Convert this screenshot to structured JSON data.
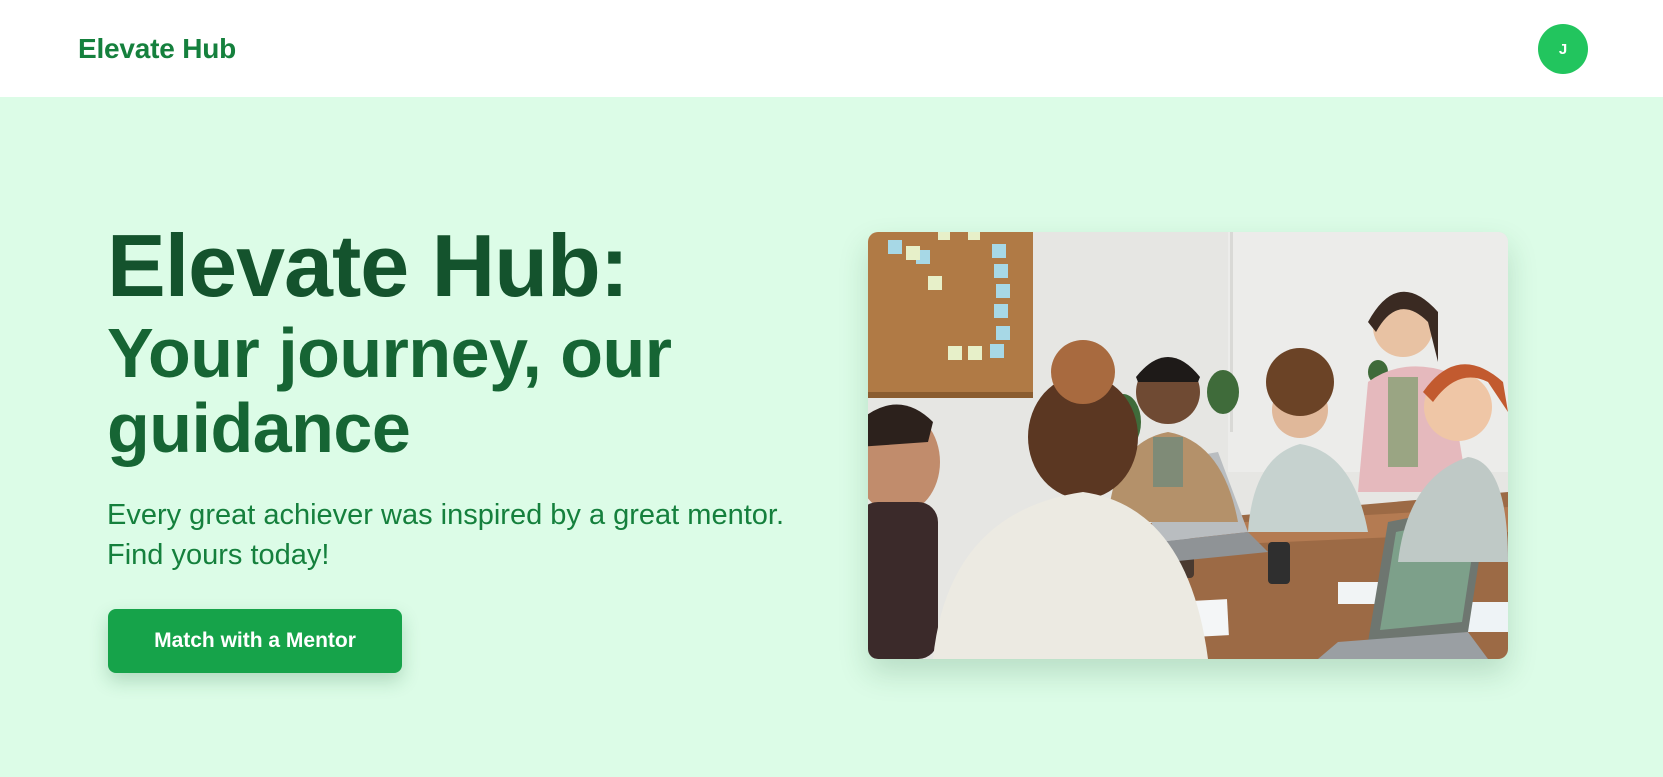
{
  "navbar": {
    "brand": "Elevate Hub",
    "avatar_initial": "J"
  },
  "hero": {
    "title": "Elevate Hub:",
    "tagline": "Your journey, our guidance",
    "subtitle": "Every great achiever was inspired by a great mentor. Find yours today!",
    "cta_label": "Match with a Mentor",
    "image_icon": "team-meeting-photo"
  },
  "colors": {
    "page_background": "#dcfce7",
    "navbar_background": "#ffffff",
    "brand": "#15803d",
    "title": "#14532d",
    "tagline": "#166534",
    "accent": "#16a34a",
    "avatar": "#22c55e"
  }
}
